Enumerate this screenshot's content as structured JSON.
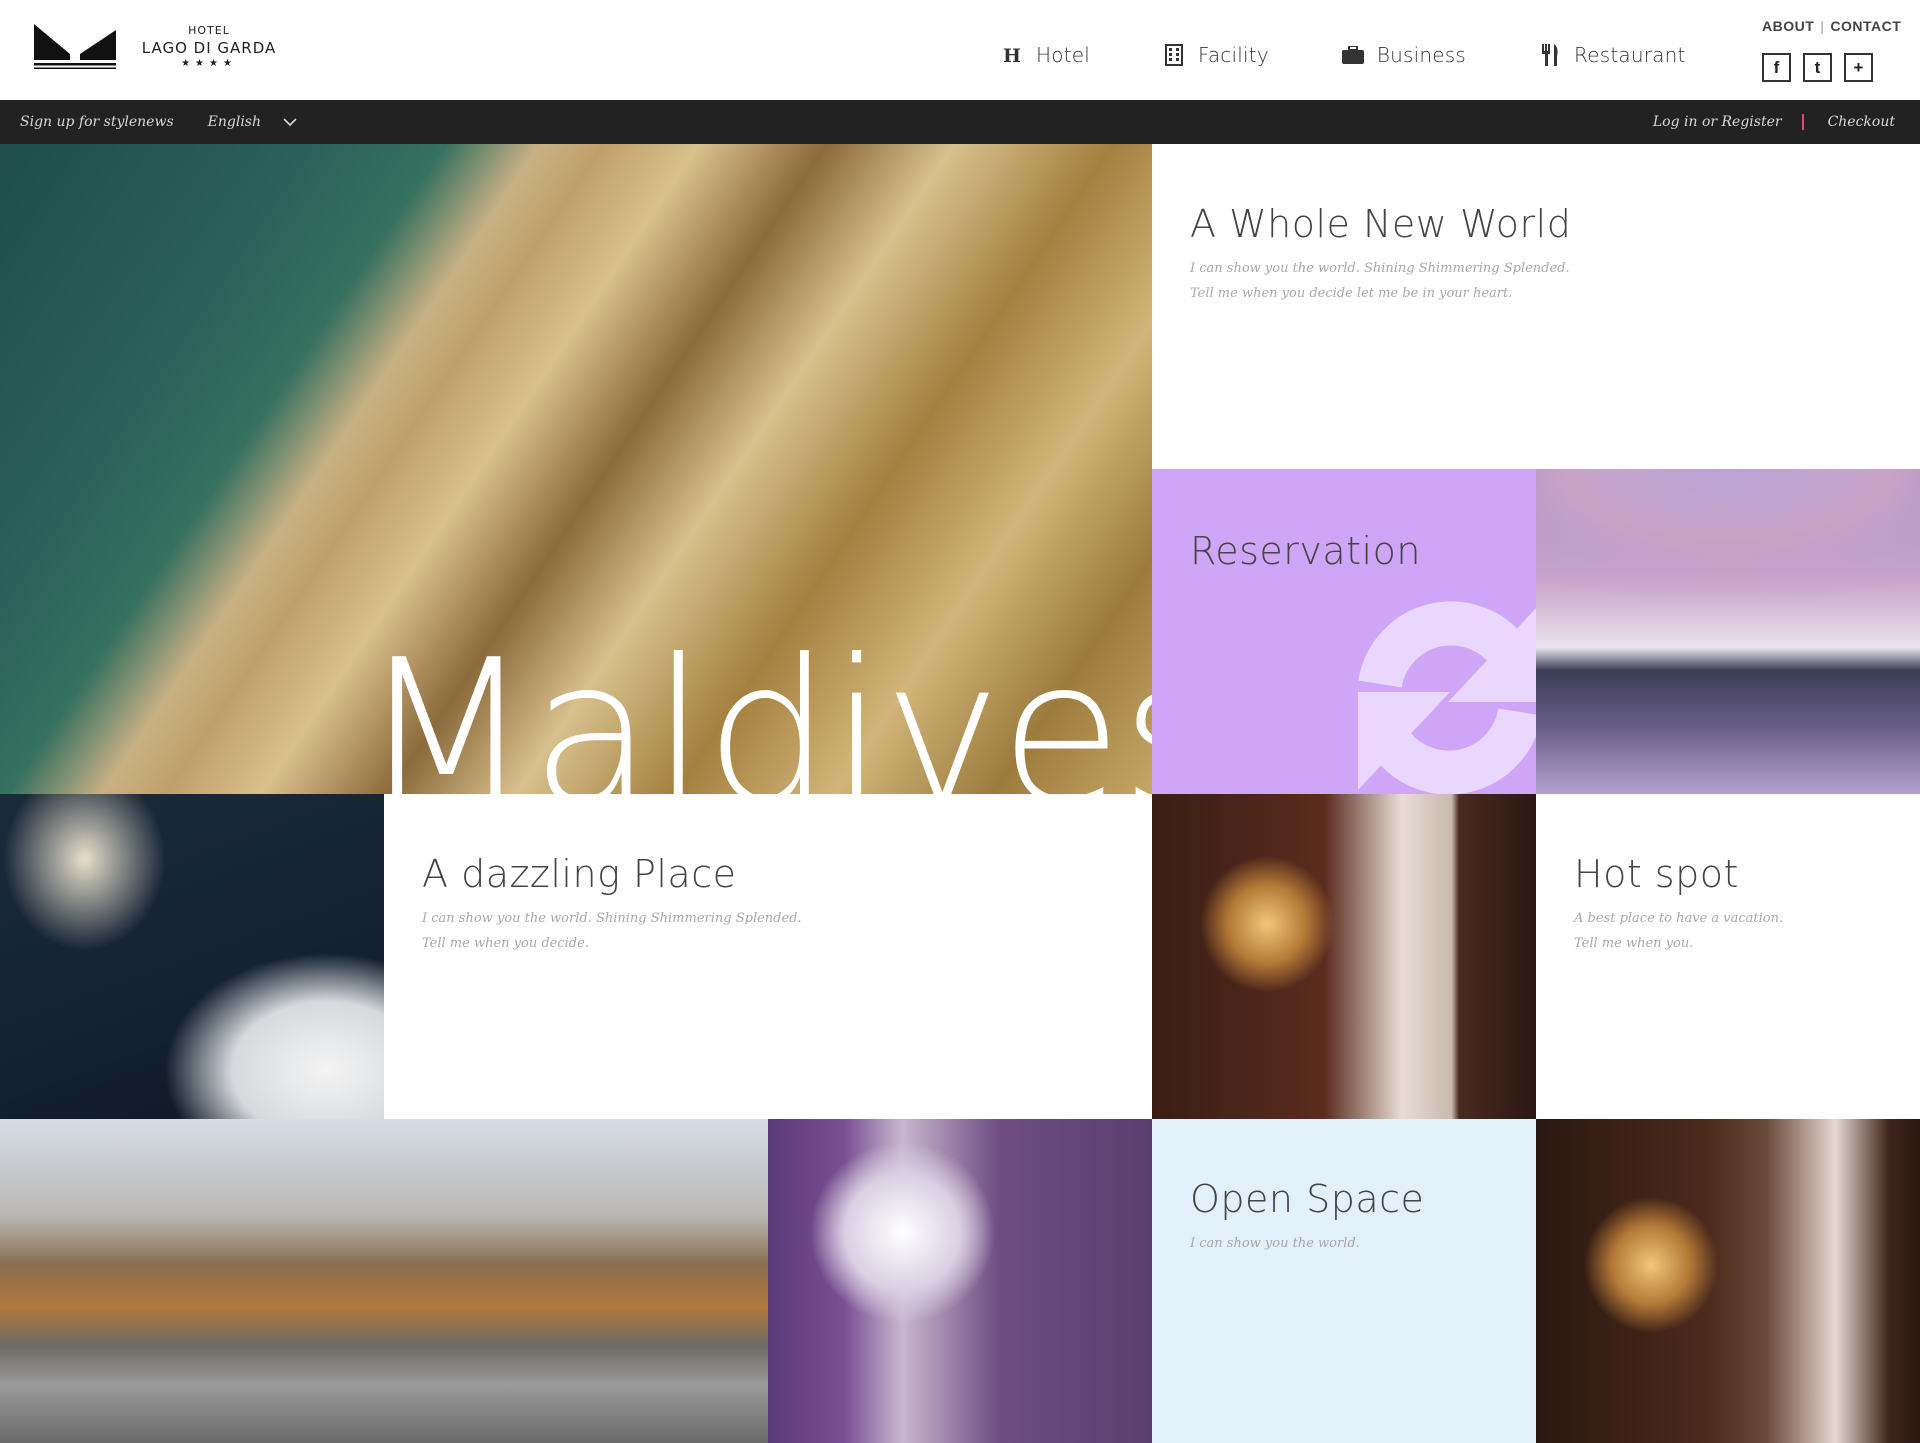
{
  "header": {
    "logo": {
      "small": "HOTEL",
      "name": "LAGO DI GARDA",
      "stars": "★★★★"
    },
    "nav": [
      {
        "label": "Hotel",
        "icon": "hotel-h-icon"
      },
      {
        "label": "Facility",
        "icon": "building-icon"
      },
      {
        "label": "Business",
        "icon": "briefcase-icon"
      },
      {
        "label": "Restaurant",
        "icon": "fork-knife-icon"
      }
    ],
    "top_links": {
      "about": "ABOUT",
      "separator": "|",
      "contact": "CONTACT"
    },
    "social": [
      {
        "glyph": "f",
        "icon": "facebook-icon"
      },
      {
        "glyph": "t",
        "icon": "twitter-icon"
      },
      {
        "glyph": "+",
        "icon": "plus-icon"
      }
    ]
  },
  "subbar": {
    "signup": "Sign up for stylenews",
    "language": "English",
    "login": "Log in or Register",
    "checkout": "Checkout",
    "divider_color": "#e0457b"
  },
  "tiles": {
    "hero": {
      "overlay_text": "Maldives"
    },
    "whole_new_world": {
      "title": "A Whole New World",
      "line1": "I can show you the world. Shining Shimmering Splended.",
      "line2": "Tell me when you decide let me be in your heart."
    },
    "reservation": {
      "title": "Reservation",
      "icon": "refresh-icon",
      "bg": "#cfa5f7"
    },
    "dazzling": {
      "title": "A dazzling Place",
      "line1": "I can show you the world. Shining Shimmering Splended.",
      "line2": "Tell me when you decide."
    },
    "hot_spot": {
      "title": "Hot spot",
      "line1": "A best place to have a vacation.",
      "line2": "Tell me when you."
    },
    "open_space": {
      "title": "Open Space",
      "line1": "I can show you the world.",
      "bg": "#e2f0fa"
    }
  }
}
